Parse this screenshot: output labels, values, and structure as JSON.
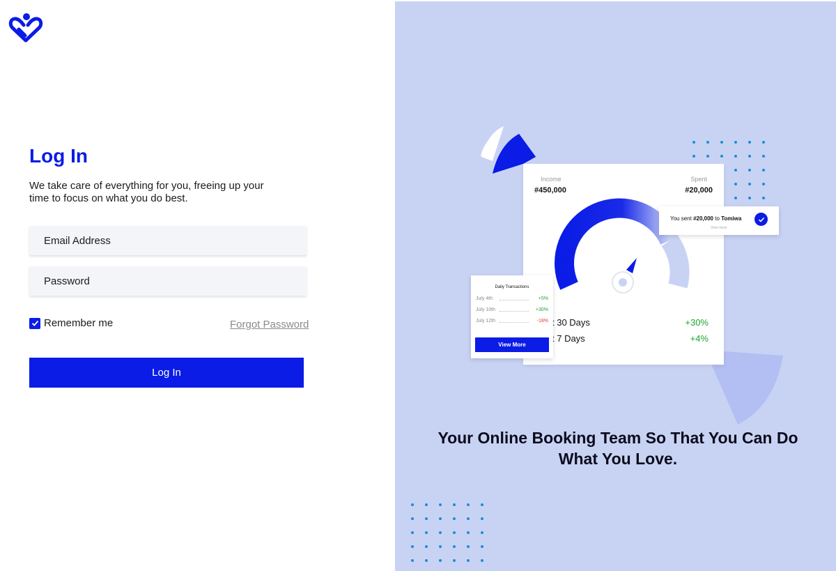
{
  "login": {
    "title": "Log In",
    "subtitle": "We take care of everything for you, freeing up your time to focus on what you do best.",
    "email_placeholder": "Email Address",
    "password_placeholder": "Password",
    "remember_label": "Remember me",
    "remember_checked": true,
    "forgot_label": "Forgot Password",
    "submit_label": "Log In"
  },
  "illustration": {
    "income_label": "Income",
    "income_value": "#450,000",
    "spent_label": "Spent",
    "spent_value": "#20,000",
    "stats": [
      {
        "label": "t 30 Days",
        "value": "+30%"
      },
      {
        "label": "t 7 Days",
        "value": "+4%"
      }
    ],
    "transactions": {
      "title": "Daily Transactions",
      "rows": [
        {
          "date": "July 4th",
          "change": "+5%"
        },
        {
          "date": "July 10th",
          "change": "+30%"
        },
        {
          "date": "July 12th",
          "change": "-18%"
        }
      ],
      "button_label": "View More"
    },
    "notification": {
      "prefix": "You sent ",
      "amount": "#20,000",
      "middle": " to ",
      "recipient": "Tomiwa",
      "sub": "View more"
    }
  },
  "tagline": "Your Online Booking Team So That You Can Do What You Love.",
  "colors": {
    "brand_blue": "#0a1ce6",
    "panel_bg": "#c8d3f4",
    "positive": "#1fa531",
    "negative": "#e5383b",
    "dot_blue": "#1a8fd6"
  },
  "icons": {
    "logo": "heart-logo-icon",
    "checkbox": "checkmark-icon",
    "notification": "check-circle-icon"
  }
}
